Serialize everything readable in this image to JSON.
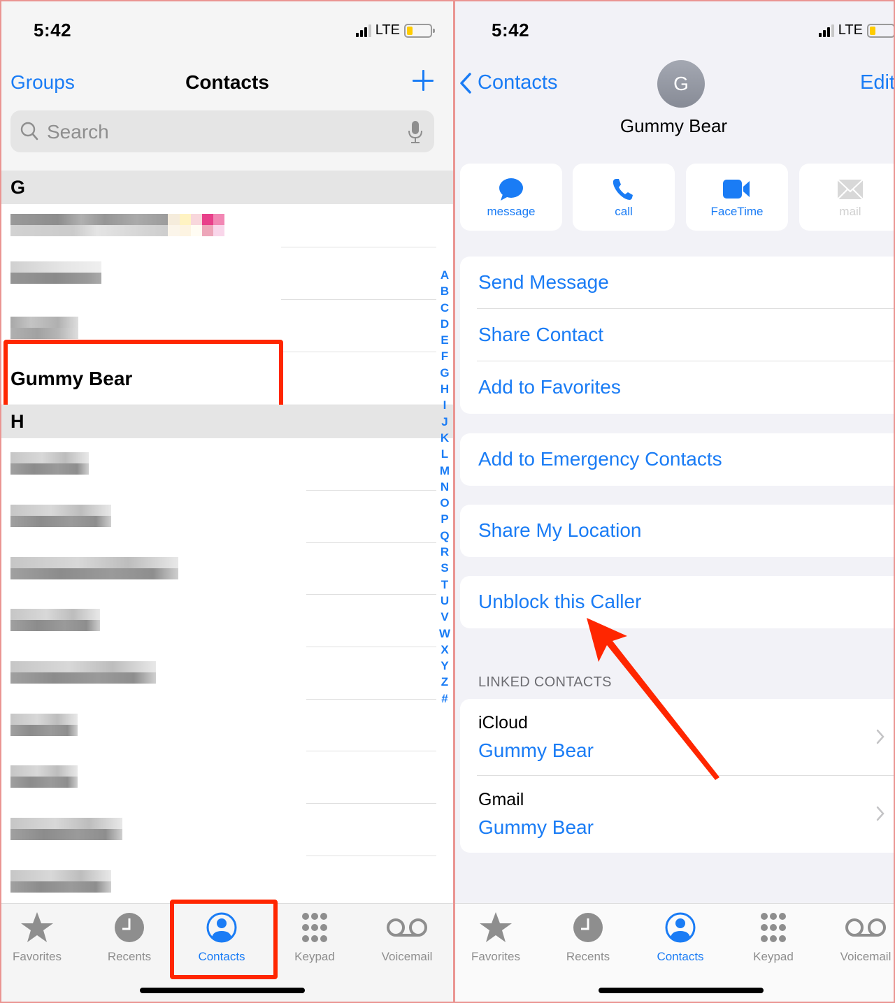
{
  "left": {
    "status": {
      "time": "5:42",
      "network": "LTE"
    },
    "nav": {
      "left_label": "Groups",
      "title": "Contacts",
      "add_icon": "plus-icon"
    },
    "search": {
      "placeholder": "Search",
      "icon": "search-icon",
      "mic_icon": "microphone-icon"
    },
    "sections": [
      {
        "letter": "G",
        "contacts": [
          "[blurred]",
          "[blurred]",
          "[blurred]",
          "Gummy Bear"
        ]
      },
      {
        "letter": "H",
        "contacts": [
          "[blurred]",
          "[blurred]",
          "[blurred]",
          "[blurred]",
          "[blurred]",
          "[blurred]",
          "[blurred]",
          "[blurred]",
          "[blurred]"
        ]
      }
    ],
    "highlighted_contact": "Gummy Bear",
    "index_letters": [
      "A",
      "B",
      "C",
      "D",
      "E",
      "F",
      "G",
      "H",
      "I",
      "J",
      "K",
      "L",
      "M",
      "N",
      "O",
      "P",
      "Q",
      "R",
      "S",
      "T",
      "U",
      "V",
      "W",
      "X",
      "Y",
      "Z",
      "#"
    ],
    "tabs": [
      {
        "label": "Favorites",
        "icon": "star-icon",
        "active": false
      },
      {
        "label": "Recents",
        "icon": "clock-icon",
        "active": false
      },
      {
        "label": "Contacts",
        "icon": "person-circle-icon",
        "active": true
      },
      {
        "label": "Keypad",
        "icon": "keypad-icon",
        "active": false
      },
      {
        "label": "Voicemail",
        "icon": "voicemail-icon",
        "active": false
      }
    ]
  },
  "right": {
    "status": {
      "time": "5:42",
      "network": "LTE"
    },
    "nav": {
      "back_label": "Contacts",
      "edit_label": "Edit"
    },
    "contact": {
      "initial": "G",
      "name": "Gummy Bear"
    },
    "actions": [
      {
        "label": "message",
        "icon": "message-bubble-icon",
        "enabled": true
      },
      {
        "label": "call",
        "icon": "phone-icon",
        "enabled": true
      },
      {
        "label": "FaceTime",
        "icon": "video-camera-icon",
        "enabled": true
      },
      {
        "label": "mail",
        "icon": "envelope-icon",
        "enabled": false
      }
    ],
    "card1": [
      "Send Message",
      "Share Contact",
      "Add to Favorites"
    ],
    "card2": [
      "Add to Emergency Contacts"
    ],
    "card3": [
      "Share My Location"
    ],
    "card4": [
      "Unblock this Caller"
    ],
    "linked_header": "LINKED CONTACTS",
    "linked": [
      {
        "source": "iCloud",
        "name": "Gummy Bear"
      },
      {
        "source": "Gmail",
        "name": "Gummy Bear"
      }
    ],
    "tabs": [
      {
        "label": "Favorites",
        "icon": "star-icon",
        "active": false
      },
      {
        "label": "Recents",
        "icon": "clock-icon",
        "active": false
      },
      {
        "label": "Contacts",
        "icon": "person-circle-icon",
        "active": true
      },
      {
        "label": "Keypad",
        "icon": "keypad-icon",
        "active": false
      },
      {
        "label": "Voicemail",
        "icon": "voicemail-icon",
        "active": false
      }
    ]
  },
  "annotations": {
    "highlight_color": "#ff2600",
    "arrow_target": "Unblock this Caller"
  },
  "colors": {
    "accent": "#1a7cf5",
    "inactive": "#8e8e8e"
  }
}
